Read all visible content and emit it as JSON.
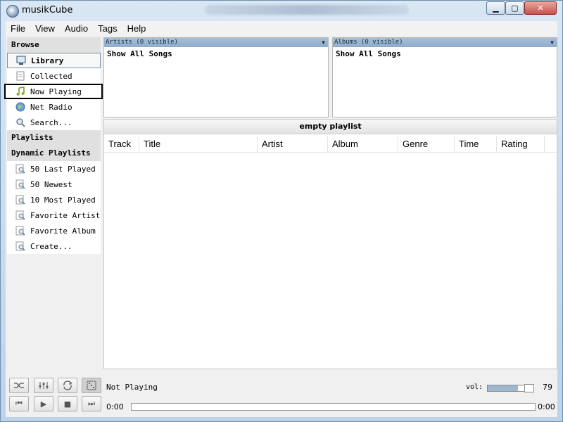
{
  "window": {
    "title": "musikCube"
  },
  "menu": [
    "File",
    "View",
    "Audio",
    "Tags",
    "Help"
  ],
  "sidebar": {
    "browse_header": "Browse",
    "browse_items": [
      {
        "label": "Library",
        "icon": "monitor-icon"
      },
      {
        "label": "Collected",
        "icon": "document-icon"
      },
      {
        "label": "Now Playing",
        "icon": "music-note-icon"
      },
      {
        "label": "Net Radio",
        "icon": "globe-icon"
      },
      {
        "label": "Search...",
        "icon": "magnifier-icon"
      }
    ],
    "playlists_header": "Playlists",
    "dynamic_header": "Dynamic Playlists",
    "dynamic_items": [
      "50 Last Played",
      "50 Newest",
      "10 Most Played",
      "Favorite Artist",
      "Favorite Album",
      "Create..."
    ]
  },
  "filters": {
    "artists": {
      "header": "Artists (0 visible)",
      "row": "Show All Songs"
    },
    "albums": {
      "header": "Albums (0 visible)",
      "row": "Show All Songs"
    }
  },
  "playlist": {
    "title": "empty playlist",
    "columns": [
      "Track",
      "Title",
      "Artist",
      "Album",
      "Genre",
      "Time",
      "Rating"
    ]
  },
  "transport": {
    "status": "Not Playing",
    "vol_label": "vol:",
    "volume": 79,
    "time_elapsed": "0:00",
    "time_total": "0:00",
    "progress": 0
  },
  "colors": {
    "accent": "#9fb7cf",
    "header_bar": "#a7bfd8"
  }
}
